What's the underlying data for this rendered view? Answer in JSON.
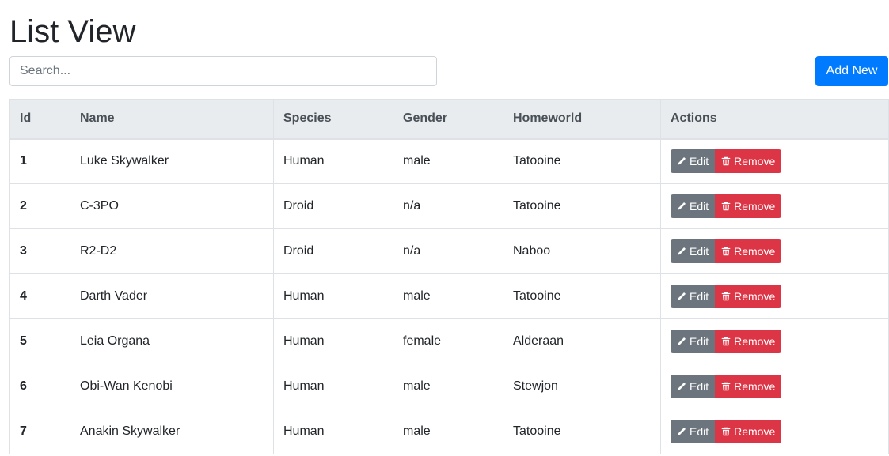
{
  "page": {
    "title": "List View"
  },
  "search": {
    "placeholder": "Search..."
  },
  "toolbar": {
    "add_label": "Add New"
  },
  "table": {
    "headers": [
      "Id",
      "Name",
      "Species",
      "Gender",
      "Homeworld",
      "Actions"
    ],
    "rows": [
      {
        "id": "1",
        "name": "Luke Skywalker",
        "species": "Human",
        "gender": "male",
        "homeworld": "Tatooine"
      },
      {
        "id": "2",
        "name": "C-3PO",
        "species": "Droid",
        "gender": "n/a",
        "homeworld": "Tatooine"
      },
      {
        "id": "3",
        "name": "R2-D2",
        "species": "Droid",
        "gender": "n/a",
        "homeworld": "Naboo"
      },
      {
        "id": "4",
        "name": "Darth Vader",
        "species": "Human",
        "gender": "male",
        "homeworld": "Tatooine"
      },
      {
        "id": "5",
        "name": "Leia Organa",
        "species": "Human",
        "gender": "female",
        "homeworld": "Alderaan"
      },
      {
        "id": "6",
        "name": "Obi-Wan Kenobi",
        "species": "Human",
        "gender": "male",
        "homeworld": "Stewjon"
      },
      {
        "id": "7",
        "name": "Anakin Skywalker",
        "species": "Human",
        "gender": "male",
        "homeworld": "Tatooine"
      }
    ],
    "actions": {
      "edit_label": "Edit",
      "remove_label": "Remove",
      "edit_icon": "pencil-icon",
      "remove_icon": "trash-icon"
    }
  },
  "colors": {
    "primary": "#007bff",
    "secondary": "#6c757d",
    "danger": "#dc3545",
    "header_bg": "#e9ecef"
  }
}
